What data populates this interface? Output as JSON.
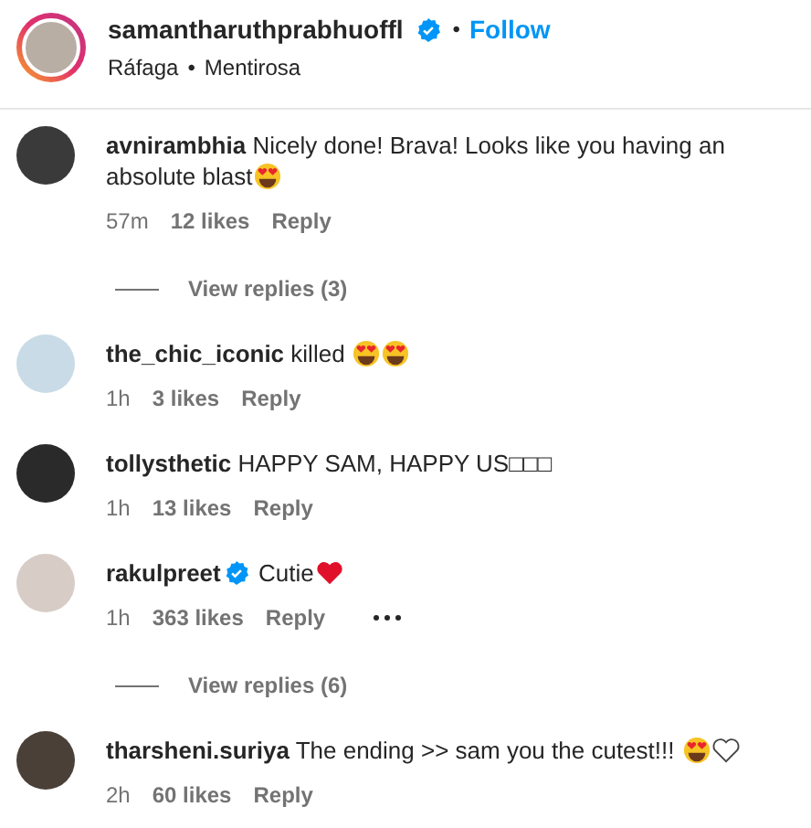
{
  "post": {
    "username": "samantharuthprabhuoffl",
    "verified": true,
    "separator": "•",
    "follow": "Follow",
    "audio": [
      "Ráfaga",
      "Mentirosa"
    ]
  },
  "comments": [
    {
      "username": "avnirambhia",
      "verified": false,
      "text": "Nicely done! Brava! Looks like you having an absolute blast",
      "emojis": [
        {
          "kind": "heart_eyes"
        }
      ],
      "time": "57m",
      "likes": "12 likes",
      "reply": "Reply",
      "more": false,
      "replies": "View replies (3)"
    },
    {
      "username": "the_chic_iconic",
      "verified": false,
      "text": "killed ",
      "emojis": [
        {
          "kind": "heart_eyes"
        },
        {
          "kind": "heart_eyes"
        }
      ],
      "time": "1h",
      "likes": "3 likes",
      "reply": "Reply",
      "more": false
    },
    {
      "username": "tollysthetic",
      "verified": false,
      "text": "HAPPY SAM, HAPPY US□□□",
      "time": "1h",
      "likes": "13 likes",
      "reply": "Reply",
      "more": false
    },
    {
      "username": "rakulpreet",
      "verified": true,
      "text": "Cutie",
      "emojis": [
        {
          "kind": "red_heart"
        }
      ],
      "time": "1h",
      "likes": "363 likes",
      "reply": "Reply",
      "more": true,
      "replies": "View replies (6)"
    },
    {
      "username": "tharsheni.suriya",
      "verified": false,
      "text": "The ending >> sam you the cutest!!! ",
      "emojis": [
        {
          "kind": "heart_eyes"
        },
        {
          "kind": "white_heart"
        }
      ],
      "time": "2h",
      "likes": "60 likes",
      "reply": "Reply",
      "more": false
    }
  ]
}
